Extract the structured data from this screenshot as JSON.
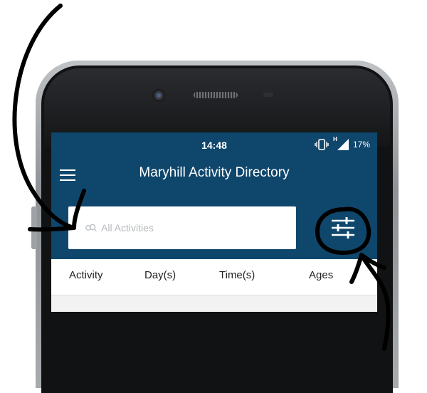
{
  "colors": {
    "brand": "#0f466c",
    "annotation_ink": "#000000"
  },
  "status_bar": {
    "time": "14:48",
    "network_label": "H",
    "battery": "17%",
    "icons": [
      "vibrate-icon",
      "signal-icon"
    ]
  },
  "app_bar": {
    "menu_icon": "hamburger-menu-icon",
    "title": "Maryhill Activity Directory"
  },
  "search": {
    "placeholder": "All Activities",
    "value": "",
    "icon": "search-icon"
  },
  "filter": {
    "icon": "filter-sliders-icon"
  },
  "columns": [
    "Activity",
    "Day(s)",
    "Time(s)",
    "Ages"
  ]
}
